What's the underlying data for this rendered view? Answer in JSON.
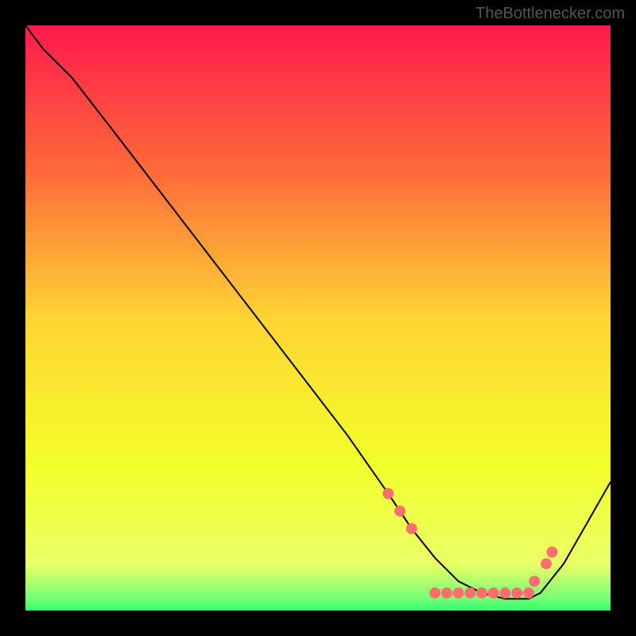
{
  "watermark": "TheBottlenecker.com",
  "chart_data": {
    "type": "line",
    "title": "",
    "xlabel": "",
    "ylabel": "",
    "xlim": [
      0,
      100
    ],
    "ylim": [
      0,
      100
    ],
    "grid": false,
    "legend": false,
    "background_gradient": {
      "stops": [
        {
          "offset": 0,
          "color": "#ff1a4d"
        },
        {
          "offset": 25,
          "color": "#ff6a3a"
        },
        {
          "offset": 50,
          "color": "#ffd433"
        },
        {
          "offset": 75,
          "color": "#f2ff2a"
        },
        {
          "offset": 92,
          "color": "#eaff66"
        },
        {
          "offset": 98,
          "color": "#76ff76"
        },
        {
          "offset": 100,
          "color": "#2cff6e"
        }
      ]
    },
    "series": [
      {
        "name": "curve",
        "type": "line",
        "color": "#000000",
        "x": [
          0,
          3,
          8,
          15,
          25,
          35,
          45,
          55,
          62,
          66,
          70,
          74,
          78,
          82,
          86,
          88,
          92,
          96,
          100
        ],
        "y": [
          100,
          96,
          91,
          82,
          69,
          56,
          43,
          30,
          20,
          14,
          9,
          5,
          3,
          2,
          2,
          3,
          8,
          15,
          22
        ]
      },
      {
        "name": "points",
        "type": "scatter",
        "color": "#ff6f6f",
        "x": [
          62,
          64,
          66,
          70,
          72,
          74,
          76,
          78,
          80,
          82,
          84,
          86,
          87,
          89,
          90
        ],
        "y": [
          20,
          17,
          14,
          3,
          3,
          3,
          3,
          3,
          3,
          3,
          3,
          3,
          5,
          8,
          10
        ]
      }
    ]
  }
}
